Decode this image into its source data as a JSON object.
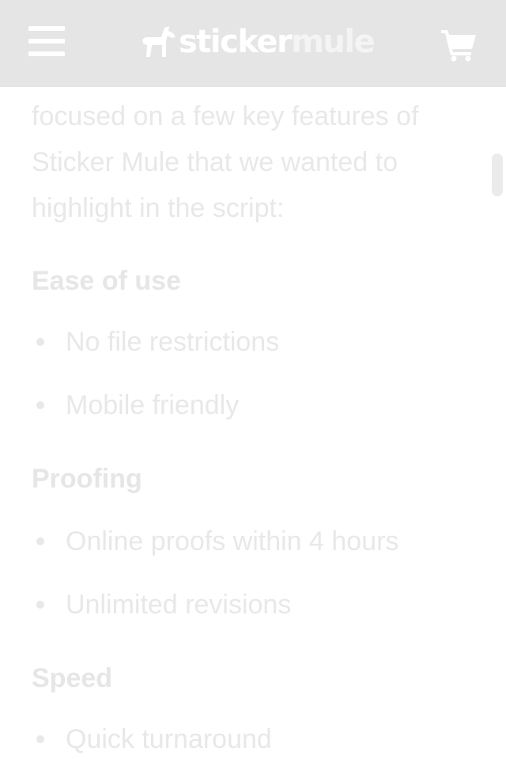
{
  "header": {
    "logo": {
      "sticker": "sticker",
      "mule": "mule"
    }
  },
  "content": {
    "intro": "focused on a few key features of Sticker Mule that we wanted to highlight in the script:",
    "sections": [
      {
        "heading": "Ease of use",
        "items": [
          "No file restrictions",
          "Mobile friendly"
        ]
      },
      {
        "heading": "Proofing",
        "items": [
          "Online proofs within 4 hours",
          "Unlimited revisions"
        ]
      },
      {
        "heading": "Speed",
        "items": [
          "Quick turnaround"
        ]
      }
    ]
  },
  "colors": {
    "header_bg": "#e5e5e5",
    "header_icon": "#ffffff",
    "text_faded": "#e8e8e8"
  },
  "icons": {
    "menu": "hamburger-menu-icon",
    "cart": "shopping-cart-icon",
    "logo": "mule-logo-icon"
  }
}
